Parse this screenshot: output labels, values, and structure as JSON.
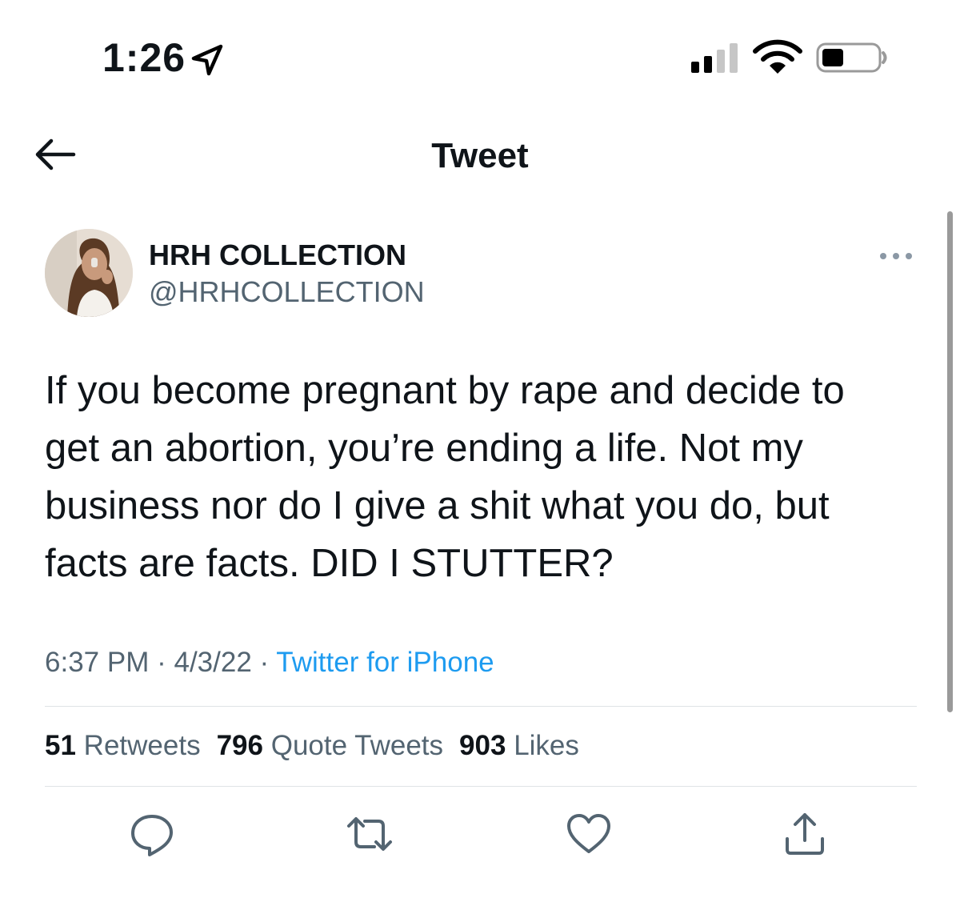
{
  "status_bar": {
    "time": "1:26",
    "location_icon": "location-arrow-icon",
    "signal_icon": "cellular-signal-icon",
    "wifi_icon": "wifi-icon",
    "battery_icon": "battery-icon"
  },
  "header": {
    "back_icon": "back-arrow-icon",
    "title": "Tweet"
  },
  "tweet": {
    "author_name": "HRH COLLECTION",
    "author_handle": "@HRHCOLLECTION",
    "more_icon": "more-options-icon",
    "text_lines": [
      "If you become pregnant by rape and decide to",
      "get an abortion, you’re ending a life. Not my",
      "business nor do I give a shit what you do, but",
      "facts are facts. DID I STUTTER?"
    ],
    "time": "6:37 PM",
    "separator": "·",
    "date": "4/3/22",
    "source": "Twitter for iPhone",
    "stats": {
      "retweets_count": "51",
      "retweets_label": "Retweets",
      "quote_count": "796",
      "quote_label": "Quote Tweets",
      "likes_count": "903",
      "likes_label": "Likes"
    }
  },
  "actions": [
    "reply-icon",
    "retweet-icon",
    "like-icon",
    "share-icon"
  ],
  "colors": {
    "text": "#0f1419",
    "secondary": "#536471",
    "link": "#1d9bf0",
    "divider": "#dfe3e6"
  }
}
